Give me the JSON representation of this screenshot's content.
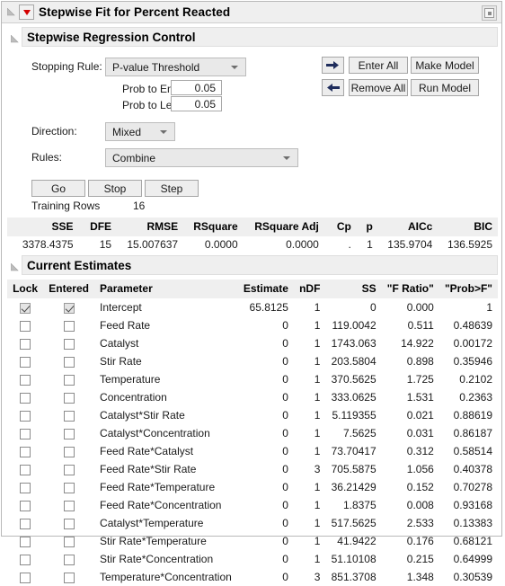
{
  "window": {
    "title": "Stepwise Fit for Percent Reacted",
    "menu_icon": "red-triangle-menu-icon",
    "restore_icon": "restore-window-icon"
  },
  "sections": {
    "control": {
      "title": "Stepwise Regression Control"
    },
    "estimates": {
      "title": "Current Estimates"
    }
  },
  "control": {
    "stopping_rule_label": "Stopping Rule:",
    "stopping_rule_value": "P-value Threshold",
    "prob_to_enter_label": "Prob to Enter",
    "prob_to_enter_value": "0.05",
    "prob_to_leave_label": "Prob to Leave",
    "prob_to_leave_value": "0.05",
    "direction_label": "Direction:",
    "direction_value": "Mixed",
    "rules_label": "Rules:",
    "rules_value": "Combine",
    "go_label": "Go",
    "stop_label": "Stop",
    "step_label": "Step",
    "training_rows_label": "Training Rows",
    "training_rows_value": "16",
    "enter_all_label": "Enter All",
    "remove_all_label": "Remove All",
    "make_model_label": "Make Model",
    "run_model_label": "Run Model",
    "enter_arrow_icon": "arrow-right-icon",
    "remove_arrow_icon": "arrow-left-icon"
  },
  "summary": {
    "headers": [
      "SSE",
      "DFE",
      "RMSE",
      "RSquare",
      "RSquare Adj",
      "Cp",
      "p",
      "AICc",
      "BIC"
    ],
    "values": [
      "3378.4375",
      "15",
      "15.007637",
      "0.0000",
      "0.0000",
      ".",
      "1",
      "135.9704",
      "136.5925"
    ]
  },
  "estimates": {
    "headers": [
      "Lock",
      "Entered",
      "Parameter",
      "Estimate",
      "nDF",
      "SS",
      "\"F Ratio\"",
      "\"Prob>F\""
    ],
    "rows": [
      {
        "lock": true,
        "entered": true,
        "parameter": "Intercept",
        "estimate": "65.8125",
        "ndf": "1",
        "ss": "0",
        "f": "0.000",
        "p": "1"
      },
      {
        "lock": false,
        "entered": false,
        "parameter": "Feed Rate",
        "estimate": "0",
        "ndf": "1",
        "ss": "119.0042",
        "f": "0.511",
        "p": "0.48639"
      },
      {
        "lock": false,
        "entered": false,
        "parameter": "Catalyst",
        "estimate": "0",
        "ndf": "1",
        "ss": "1743.063",
        "f": "14.922",
        "p": "0.00172"
      },
      {
        "lock": false,
        "entered": false,
        "parameter": "Stir Rate",
        "estimate": "0",
        "ndf": "1",
        "ss": "203.5804",
        "f": "0.898",
        "p": "0.35946"
      },
      {
        "lock": false,
        "entered": false,
        "parameter": "Temperature",
        "estimate": "0",
        "ndf": "1",
        "ss": "370.5625",
        "f": "1.725",
        "p": "0.2102"
      },
      {
        "lock": false,
        "entered": false,
        "parameter": "Concentration",
        "estimate": "0",
        "ndf": "1",
        "ss": "333.0625",
        "f": "1.531",
        "p": "0.2363"
      },
      {
        "lock": false,
        "entered": false,
        "parameter": "Catalyst*Stir Rate",
        "estimate": "0",
        "ndf": "1",
        "ss": "5.119355",
        "f": "0.021",
        "p": "0.88619"
      },
      {
        "lock": false,
        "entered": false,
        "parameter": "Catalyst*Concentration",
        "estimate": "0",
        "ndf": "1",
        "ss": "7.5625",
        "f": "0.031",
        "p": "0.86187"
      },
      {
        "lock": false,
        "entered": false,
        "parameter": "Feed Rate*Catalyst",
        "estimate": "0",
        "ndf": "1",
        "ss": "73.70417",
        "f": "0.312",
        "p": "0.58514"
      },
      {
        "lock": false,
        "entered": false,
        "parameter": "Feed Rate*Stir Rate",
        "estimate": "0",
        "ndf": "3",
        "ss": "705.5875",
        "f": "1.056",
        "p": "0.40378"
      },
      {
        "lock": false,
        "entered": false,
        "parameter": "Feed Rate*Temperature",
        "estimate": "0",
        "ndf": "1",
        "ss": "36.21429",
        "f": "0.152",
        "p": "0.70278"
      },
      {
        "lock": false,
        "entered": false,
        "parameter": "Feed Rate*Concentration",
        "estimate": "0",
        "ndf": "1",
        "ss": "1.8375",
        "f": "0.008",
        "p": "0.93168"
      },
      {
        "lock": false,
        "entered": false,
        "parameter": "Catalyst*Temperature",
        "estimate": "0",
        "ndf": "1",
        "ss": "517.5625",
        "f": "2.533",
        "p": "0.13383"
      },
      {
        "lock": false,
        "entered": false,
        "parameter": "Stir Rate*Temperature",
        "estimate": "0",
        "ndf": "1",
        "ss": "41.9422",
        "f": "0.176",
        "p": "0.68121"
      },
      {
        "lock": false,
        "entered": false,
        "parameter": "Stir Rate*Concentration",
        "estimate": "0",
        "ndf": "1",
        "ss": "51.10108",
        "f": "0.215",
        "p": "0.64999"
      },
      {
        "lock": false,
        "entered": false,
        "parameter": "Temperature*Concentration",
        "estimate": "0",
        "ndf": "3",
        "ss": "851.3708",
        "f": "1.348",
        "p": "0.30539"
      }
    ]
  },
  "colors": {
    "header_bg": "#efefef",
    "menu_red": "#d40000",
    "arrow_navy": "#1f2d5c",
    "border": "#b9b9b9"
  }
}
